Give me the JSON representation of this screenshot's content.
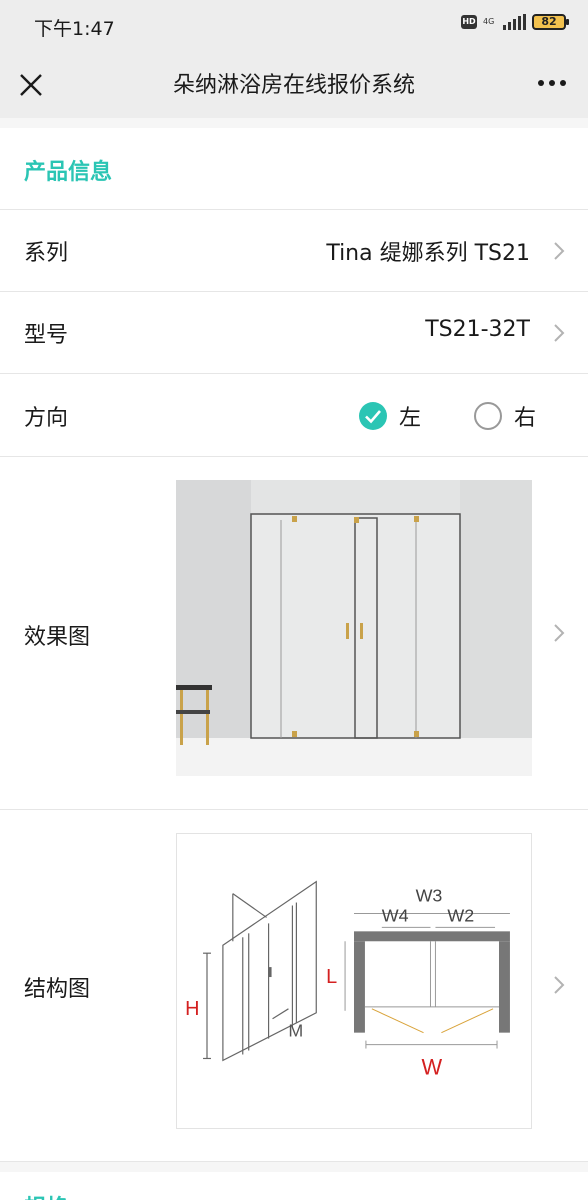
{
  "status_bar": {
    "time": "下午1:47",
    "hd_badge": "HD",
    "network": "4G",
    "battery": "82"
  },
  "nav": {
    "title": "朵纳淋浴房在线报价系统"
  },
  "product_info": {
    "heading": "产品信息",
    "series": {
      "label": "系列",
      "value": "Tina 缇娜系列 TS21"
    },
    "model": {
      "label": "型号",
      "value": "TS21-32T"
    },
    "direction": {
      "label": "方向",
      "options": [
        {
          "label": "左",
          "selected": true
        },
        {
          "label": "右",
          "selected": false
        }
      ]
    },
    "render_image": {
      "label": "效果图"
    },
    "structure_image": {
      "label": "结构图",
      "dimension_labels": {
        "h": "H",
        "m": "M",
        "l": "L",
        "w": "W",
        "w2": "W2",
        "w3": "W3",
        "w4": "W4"
      }
    }
  },
  "specs": {
    "heading": "规格"
  },
  "colors": {
    "accent": "#2bc5b4",
    "dimension_red": "#d42020",
    "header_bg": "#ededed"
  }
}
